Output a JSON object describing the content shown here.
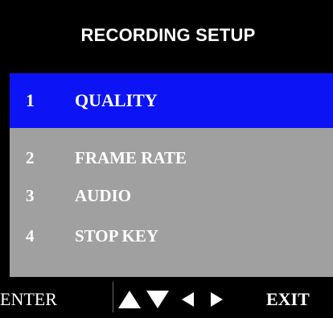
{
  "header": {
    "title": "RECORDING SETUP"
  },
  "menu": {
    "selected_index": 0,
    "items": [
      {
        "number": "1",
        "label": "QUALITY"
      },
      {
        "number": "2",
        "label": "FRAME RATE"
      },
      {
        "number": "3",
        "label": "AUDIO"
      },
      {
        "number": "4",
        "label": "STOP KEY"
      }
    ]
  },
  "footer": {
    "enter_label": "ENTER",
    "exit_label": "EXIT",
    "nav_icons": [
      "arrow-up-icon",
      "arrow-down-icon",
      "arrow-left-icon",
      "arrow-right-icon"
    ]
  },
  "colors": {
    "background": "#000000",
    "highlight": "#0c14f5",
    "panel": "#a0a0a0",
    "text": "#ffffff"
  }
}
